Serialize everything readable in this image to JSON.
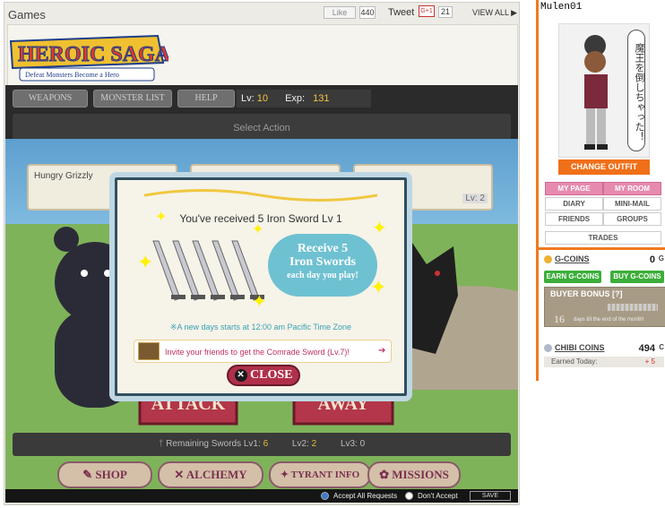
{
  "games": {
    "title": "Games",
    "like_label": "Like",
    "like_count": "440",
    "tweet_label": "Tweet",
    "gplus_label": "G+1",
    "gplus_count": "21",
    "view_all": "VIEW ALL ▶"
  },
  "game": {
    "logo_title": "HEROIC SAGA",
    "logo_subtitle": "Defeat Monsters Become a Hero",
    "tabs": [
      "WEAPONS",
      "MONSTER LIST",
      "HELP"
    ],
    "level_label": "Lv:",
    "level_value": "10",
    "exp_label": "Exp:",
    "exp_value": "131",
    "select_action": "Select Action",
    "enemy_name": "Hungry Grizzly",
    "enemy_level": "Lv: 2",
    "attack_label": "ATTACK",
    "away_label": "AWAY",
    "swords_label": "Remaining Swords",
    "swords": [
      {
        "label": "Lv1:",
        "value": "6"
      },
      {
        "label": "Lv2:",
        "value": "2"
      },
      {
        "label": "Lv3:",
        "value": "0"
      }
    ],
    "nav": [
      "SHOP",
      "ALCHEMY",
      "TYRANT INFO",
      "MISSIONS"
    ]
  },
  "modal": {
    "title": "You've received 5 Iron Sword Lv 1",
    "bubble_line1": "Receive 5",
    "bubble_line2": "Iron Swords",
    "bubble_line3": "each day you play!",
    "new_days": "※A new days starts at 12:00 am Pacific Time Zone",
    "invite": "Invite your friends to get the Comrade Sword (Lv.7)!",
    "close": "CLOSE"
  },
  "requests": {
    "accept": "Accept All Requests",
    "dont": "Don't Accept",
    "save": "SAVE"
  },
  "sidebar": {
    "username": "Mulen01",
    "speech": "魔王を倒しちゃった！",
    "change_outfit": "CHANGE OUTFIT",
    "buttons": [
      "MY PAGE",
      "MY ROOM",
      "DIARY",
      "MINI-MAIL",
      "FRIENDS",
      "GROUPS",
      "TRADES"
    ],
    "gcoins_label": "G-COINS",
    "gcoins_value": "0",
    "gcoins_unit": "G",
    "earn_gcoins": "EARN G-COINS",
    "buy_gcoins": "BUY G-COINS",
    "buyer_bonus": "BUYER BONUS [?]",
    "buyer_days": "16",
    "buyer_note": "days till the end of the month!",
    "chibi_label": "CHIBI COINS",
    "chibi_value": "494",
    "chibi_unit": "C",
    "earned_label": "Earned Today:",
    "earned_value": "+ 5"
  },
  "colors": {
    "accent_orange": "#f07a20",
    "pink": "#e68ab0",
    "green": "#3cae3a",
    "modal_border": "#2f4f5f"
  }
}
